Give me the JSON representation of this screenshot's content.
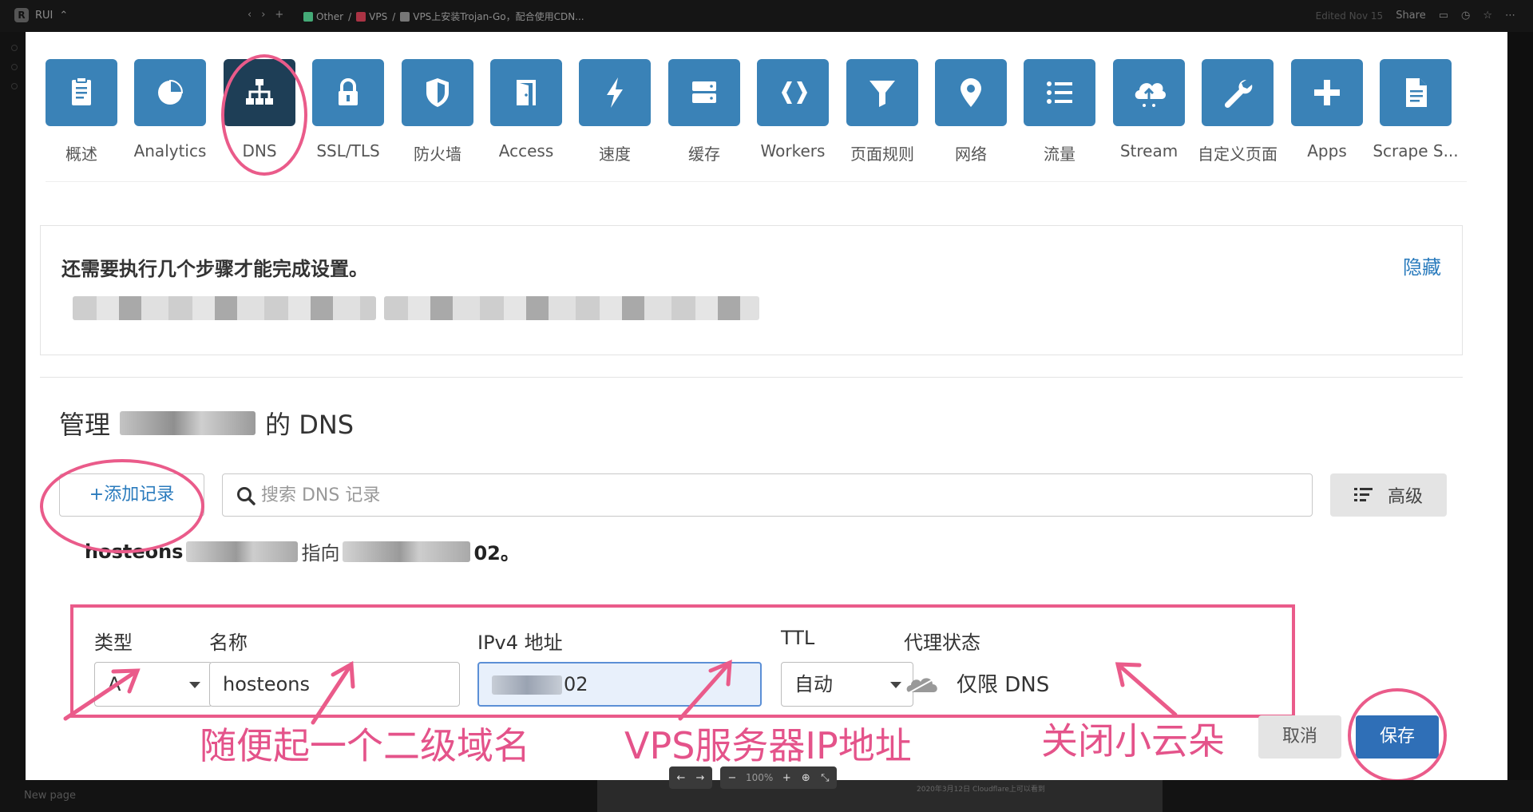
{
  "app": {
    "workspace": "RUI",
    "breadcrumbs": [
      "Other",
      "VPS",
      "VPS上安装Trojan-Go，配合使用CDN..."
    ],
    "edited": "Edited Nov 15",
    "share": "Share",
    "new_page": "New page",
    "bottom_caption": "2020年3月12日 Cloudflare上可以看到"
  },
  "viewer": {
    "zoom": "100%",
    "prev": "←",
    "next": "→",
    "zoom_out": "−",
    "zoom_in": "+"
  },
  "screenshot": {
    "nav_tiles": [
      {
        "label": "概述",
        "icon": "clipboard-icon"
      },
      {
        "label": "Analytics",
        "icon": "pie-chart-icon"
      },
      {
        "label": "DNS",
        "icon": "sitemap-icon",
        "active": true
      },
      {
        "label": "SSL/TLS",
        "icon": "lock-icon"
      },
      {
        "label": "防火墙",
        "icon": "shield-icon"
      },
      {
        "label": "Access",
        "icon": "door-icon"
      },
      {
        "label": "速度",
        "icon": "lightning-icon"
      },
      {
        "label": "缓存",
        "icon": "server-icon"
      },
      {
        "label": "Workers",
        "icon": "workers-icon"
      },
      {
        "label": "页面规则",
        "icon": "filter-icon"
      },
      {
        "label": "网络",
        "icon": "location-pin-icon"
      },
      {
        "label": "流量",
        "icon": "list-icon"
      },
      {
        "label": "Stream",
        "icon": "cloud-upload-icon"
      },
      {
        "label": "自定义页面",
        "icon": "wrench-icon"
      },
      {
        "label": "Apps",
        "icon": "plus-icon"
      },
      {
        "label": "Scrape S...",
        "icon": "document-icon"
      }
    ],
    "steps": {
      "title": "还需要执行几个步骤才能完成设置。",
      "hide": "隐藏"
    },
    "dns": {
      "title_prefix": "管理",
      "title_suffix": "的 DNS",
      "add_record": "+添加记录",
      "search_placeholder": "搜索 DNS 记录",
      "advanced": "高级",
      "record_host": "hosteons",
      "record_points": "指向",
      "record_ip_tail": "02。",
      "fields": {
        "type_label": "类型",
        "type_value": "A",
        "name_label": "名称",
        "name_value": "hosteons",
        "ip_label": "IPv4 地址",
        "ip_value_tail": "02",
        "ttl_label": "TTL",
        "ttl_value": "自动",
        "proxy_label": "代理状态",
        "proxy_value": "仅限 DNS"
      },
      "cancel": "取消",
      "save": "保存"
    },
    "annotations": {
      "subdomain": "随便起一个二级域名",
      "vps_ip": "VPS服务器IP地址",
      "cloud_off": "关闭小云朵"
    },
    "colors": {
      "tile": "#3a82b7",
      "tile_active": "#1e3e56",
      "annotation": "#ea5b8a",
      "link": "#2a7bbd"
    }
  }
}
